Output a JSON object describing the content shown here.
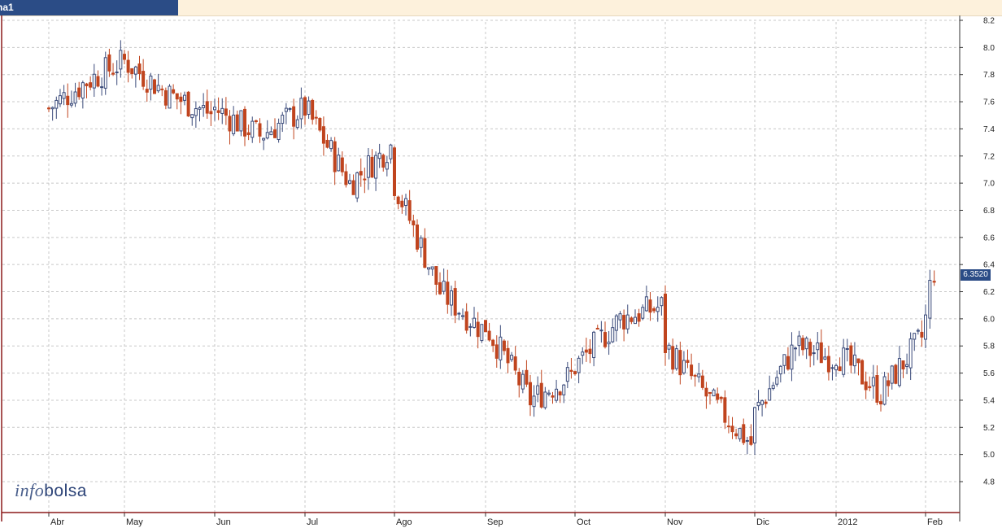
{
  "window": {
    "tab_label": "na1"
  },
  "logo": {
    "part1": "info",
    "part2": "bolsa"
  },
  "chart_data": {
    "type": "candlestick",
    "ylim": [
      4.7,
      8.2
    ],
    "y_ticks": [
      "8.2",
      "8.0",
      "7.8",
      "7.6",
      "7.4",
      "7.2",
      "7.0",
      "6.8",
      "6.6",
      "6.4",
      "6.2",
      "6.0",
      "5.8",
      "5.6",
      "5.4",
      "5.2",
      "5.0",
      "4.8"
    ],
    "x_labels": [
      "Abr",
      "May",
      "Jun",
      "Jul",
      "Ago",
      "Sep",
      "Oct",
      "Nov",
      "Dic",
      "2012",
      "Feb"
    ],
    "grid": true,
    "last_value_label": "6.3520",
    "colors": {
      "up": "#3a4a7a",
      "down": "#c0441e",
      "grid": "#c8c8c8",
      "axis": "#8b1a1a"
    },
    "monthly_path": [
      {
        "month": "Abr",
        "start": 7.55,
        "mid": 7.75,
        "end": 7.9
      },
      {
        "month": "May",
        "start": 7.9,
        "mid": 7.65,
        "end": 7.5
      },
      {
        "month": "Jun",
        "start": 7.55,
        "mid": 7.35,
        "end": 7.55
      },
      {
        "month": "Jul",
        "start": 7.55,
        "mid": 7.0,
        "end": 7.3
      },
      {
        "month": "Ago",
        "start": 7.0,
        "mid": 6.2,
        "end": 5.9
      },
      {
        "month": "Sep",
        "start": 5.95,
        "mid": 5.4,
        "end": 5.6
      },
      {
        "month": "Oct",
        "start": 5.65,
        "mid": 6.0,
        "end": 6.1
      },
      {
        "month": "Nov",
        "start": 5.8,
        "mid": 5.4,
        "end": 5.05
      },
      {
        "month": "Dic",
        "start": 5.3,
        "mid": 5.8,
        "end": 5.7
      },
      {
        "month": "2012",
        "start": 5.75,
        "mid": 5.45,
        "end": 5.9
      },
      {
        "month": "Feb",
        "start": 6.0,
        "mid": 6.35,
        "end": 6.35
      }
    ]
  }
}
